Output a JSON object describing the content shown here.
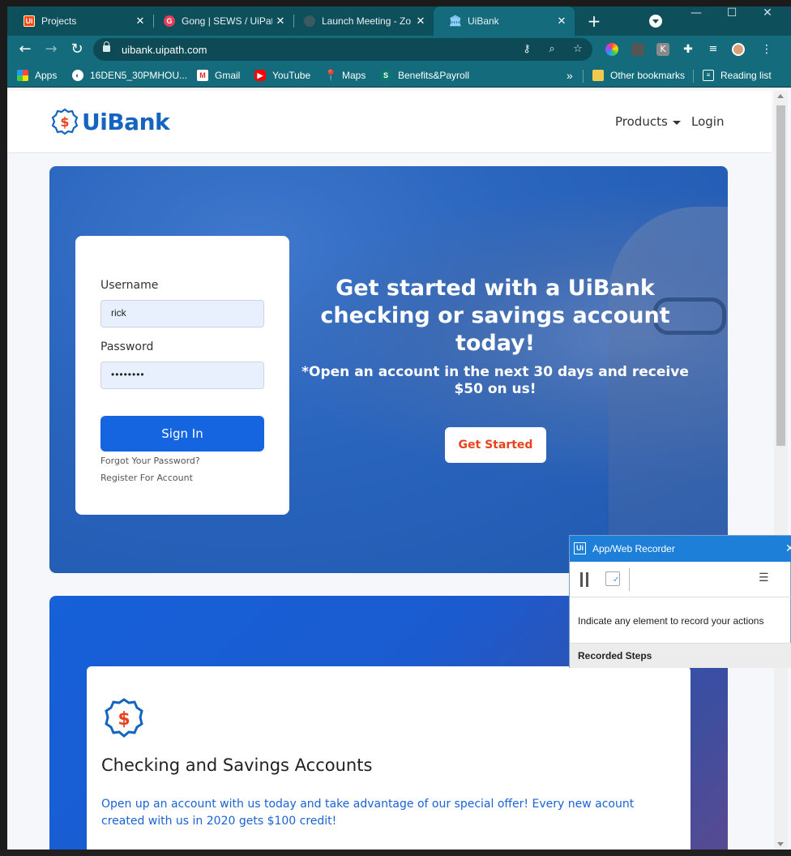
{
  "browser": {
    "tabs": [
      {
        "label": "Projects",
        "icon": "uipath-icon"
      },
      {
        "label": "Gong | SEWS / UiPat",
        "icon": "gong-icon"
      },
      {
        "label": "Launch Meeting - Zo",
        "icon": "zoom-icon"
      },
      {
        "label": "UiBank",
        "icon": "bank-icon",
        "active": true
      }
    ],
    "url": "uibank.uipath.com",
    "bookmarks": [
      {
        "label": "Apps"
      },
      {
        "label": "16DEN5_30PMHOU..."
      },
      {
        "label": "Gmail"
      },
      {
        "label": "YouTube"
      },
      {
        "label": "Maps"
      },
      {
        "label": "Benefits&Payroll"
      }
    ],
    "more_bookmarks": "»",
    "other_bookmarks": "Other bookmarks",
    "reading_list": "Reading list"
  },
  "site": {
    "logo_text": "UiBank",
    "logo_symbol": "$",
    "nav_products": "Products",
    "nav_login": "Login",
    "accent": "#1565c0"
  },
  "login": {
    "username_label": "Username",
    "username_value": "rick",
    "password_label": "Password",
    "password_value": "••••••••",
    "sign_in": "Sign In",
    "forgot": "Forgot Your Password?",
    "register": "Register For Account"
  },
  "hero": {
    "title": "Get started with a UiBank checking or savings account today!",
    "subtitle": "*Open an account in the next 30 days and receive $50 on us!",
    "cta": "Get Started",
    "cta_color": "#e8431e"
  },
  "feature": {
    "symbol": "$",
    "title": "Checking and Savings Accounts",
    "text": "Open up an account with us today and take advantage of our special offer! Every new acount created with us in 2020 gets $100 credit!"
  },
  "recorder": {
    "title": "App/Web Recorder",
    "hint": "Indicate any element to record your actions",
    "steps_label": "Recorded Steps"
  }
}
